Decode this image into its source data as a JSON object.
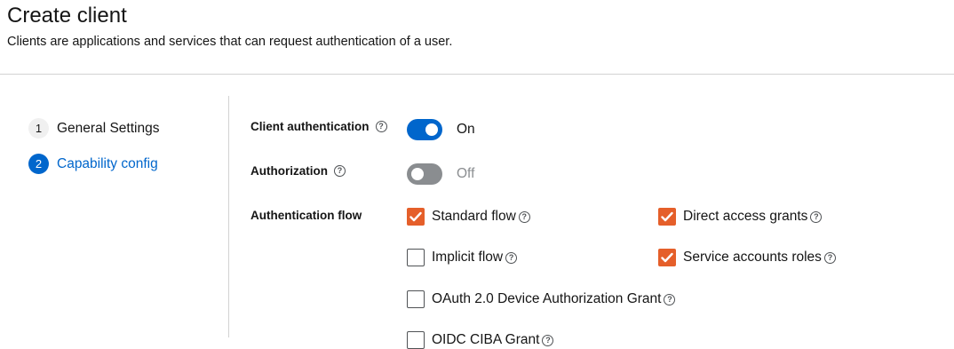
{
  "header": {
    "title": "Create client",
    "subtitle": "Clients are applications and services that can request authentication of a user."
  },
  "wizard": {
    "steps": [
      {
        "number": "1",
        "label": "General Settings",
        "active": false
      },
      {
        "number": "2",
        "label": "Capability config",
        "active": true
      }
    ]
  },
  "form": {
    "client_authentication": {
      "label": "Client authentication",
      "state": "On",
      "enabled": true
    },
    "authorization": {
      "label": "Authorization",
      "state": "Off",
      "enabled": false
    },
    "authentication_flow": {
      "label": "Authentication flow",
      "options": [
        {
          "label": "Standard flow",
          "checked": true
        },
        {
          "label": "Direct access grants",
          "checked": true
        },
        {
          "label": "Implicit flow",
          "checked": false
        },
        {
          "label": "Service accounts roles",
          "checked": true
        },
        {
          "label": "OAuth 2.0 Device Authorization Grant",
          "checked": false
        },
        {
          "label": "OIDC CIBA Grant",
          "checked": false
        }
      ]
    }
  },
  "icons": {
    "help": "help-circle-icon",
    "check": "check-icon"
  },
  "colors": {
    "primary": "#0066cc",
    "checkbox_checked": "#e55f2a",
    "switch_off": "#8a8d90",
    "divider": "#d2d2d2"
  }
}
